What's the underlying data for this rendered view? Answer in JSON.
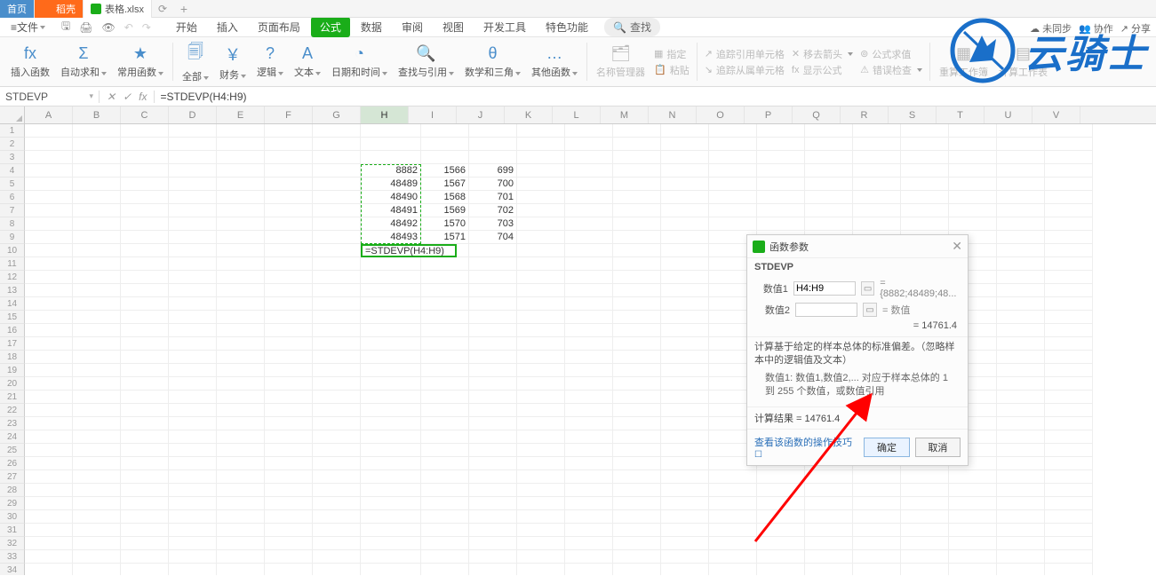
{
  "tabs": {
    "home": "首页",
    "daoke": "稻壳",
    "file": "表格.xlsx"
  },
  "topright": {
    "sync": "未同步",
    "collab": "协作",
    "share": "分享"
  },
  "menu": {
    "file": "文件"
  },
  "ribbon_tabs": [
    "开始",
    "插入",
    "页面布局",
    "公式",
    "数据",
    "审阅",
    "视图",
    "开发工具",
    "特色功能"
  ],
  "search": "查找",
  "ribbon_groups": {
    "insertfn": "插入函数",
    "autosum": "自动求和",
    "common": "常用函数",
    "all": "全部",
    "finance": "财务",
    "logic": "逻辑",
    "text": "文本",
    "datetime": "日期和时间",
    "lookup": "查找与引用",
    "math": "数学和三角",
    "other": "其他函数",
    "namemgr": "名称管理器",
    "paste": "粘贴",
    "trace_pre": "追踪引用单元格",
    "trace_dep": "追踪从属单元格",
    "goto_pre": "移去箭头",
    "show_formula": "显示公式",
    "formula_req": "公式求值",
    "error_check": "错误检查",
    "calc_book": "重算工作簿",
    "calc_sheet": "计算工作表",
    "assign": "指定"
  },
  "formula_bar": {
    "name": "STDEVP",
    "formula": "=STDEVP(H4:H9)"
  },
  "columns": [
    "A",
    "B",
    "C",
    "D",
    "E",
    "F",
    "G",
    "H",
    "I",
    "J",
    "K",
    "L",
    "M",
    "N",
    "O",
    "P",
    "Q",
    "R",
    "S",
    "T",
    "U",
    "V"
  ],
  "cells": {
    "H4": "8882",
    "I4": "1566",
    "J4": "699",
    "H5": "48489",
    "I5": "1567",
    "J5": "700",
    "H6": "48490",
    "I6": "1568",
    "J6": "701",
    "H7": "48491",
    "I7": "1569",
    "J7": "702",
    "H8": "48492",
    "I8": "1570",
    "J8": "703",
    "H9": "48493",
    "I9": "1571",
    "J9": "704"
  },
  "active_cell_text": "=STDEVP(H4:H9)",
  "dialog": {
    "title": "函数参数",
    "fn": "STDEVP",
    "arg1_label": "数值1",
    "arg1_value": "H4:H9",
    "arg1_eval": "= {8882;48489;48...",
    "arg2_label": "数值2",
    "arg2_placeholder": "",
    "arg2_eval": "= 数值",
    "calc_eq": "= 14761.4",
    "desc": "计算基于给定的样本总体的标准偏差。（忽略样本中的逻辑值及文本）",
    "arg_desc": "数值1: 数值1,数值2,... 对应于样本总体的 1 到 255 个数值，或数值引用",
    "result_label": "计算结果 = 14761.4",
    "link": "查看该函数的操作技巧",
    "ok": "确定",
    "cancel": "取消"
  },
  "watermark": "云骑士",
  "chart_data": null
}
